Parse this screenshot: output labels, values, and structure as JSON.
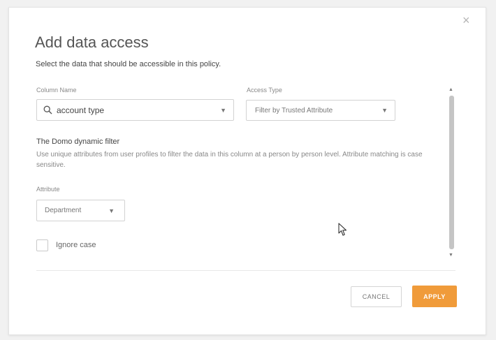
{
  "dialog": {
    "close_symbol": "×",
    "title": "Add data access",
    "subtitle": "Select the data that should be accessible in this policy."
  },
  "column_name": {
    "label": "Column Name",
    "value": "account type",
    "icon": "search-icon"
  },
  "access_type": {
    "label": "Access Type",
    "value": "Filter by Trusted Attribute"
  },
  "dynamic_filter": {
    "title": "The Domo dynamic filter",
    "description": "Use unique attributes from user profiles to filter the data in this column at a person by person level. Attribute matching is case sensitive."
  },
  "attribute": {
    "label": "Attribute",
    "value": "Department"
  },
  "ignore_case": {
    "label": "Ignore case",
    "checked": false
  },
  "buttons": {
    "cancel": "CANCEL",
    "apply": "APPLY"
  },
  "colors": {
    "accent": "#f09b3a",
    "scroll_thumb": "#c5c5c5"
  }
}
